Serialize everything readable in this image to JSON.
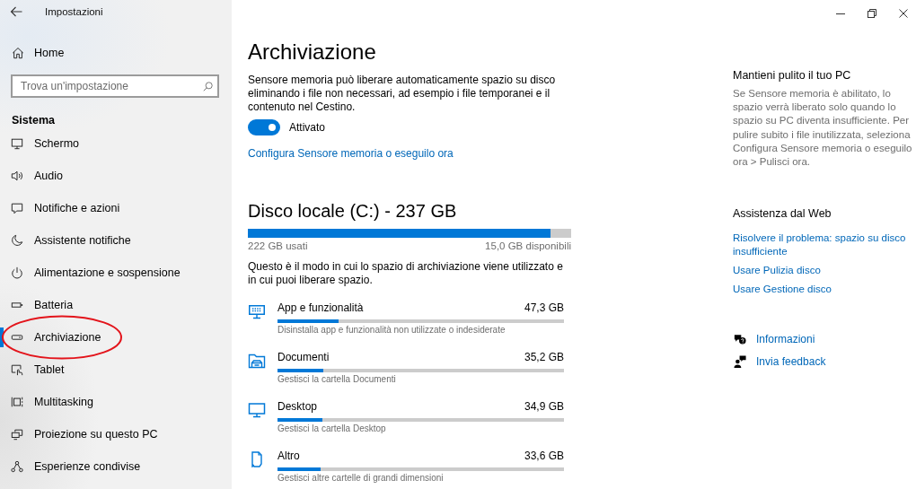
{
  "window": {
    "title": "Impostazioni"
  },
  "sidebar": {
    "home": "Home",
    "search": {
      "placeholder": "Trova un'impostazione"
    },
    "section": "Sistema",
    "items": [
      {
        "label": "Schermo",
        "selected": false,
        "circled": false
      },
      {
        "label": "Audio",
        "selected": false,
        "circled": false
      },
      {
        "label": "Notifiche e azioni",
        "selected": false,
        "circled": false
      },
      {
        "label": "Assistente notifiche",
        "selected": false,
        "circled": false
      },
      {
        "label": "Alimentazione e sospensione",
        "selected": false,
        "circled": false
      },
      {
        "label": "Batteria",
        "selected": false,
        "circled": false
      },
      {
        "label": "Archiviazione",
        "selected": true,
        "circled": true
      },
      {
        "label": "Tablet",
        "selected": false,
        "circled": false
      },
      {
        "label": "Multitasking",
        "selected": false,
        "circled": false
      },
      {
        "label": "Proiezione su questo PC",
        "selected": false,
        "circled": false
      },
      {
        "label": "Esperienze condivise",
        "selected": false,
        "circled": false
      }
    ]
  },
  "main": {
    "title": "Archiviazione",
    "description": "Sensore memoria può liberare automaticamente spazio su disco eliminando i file non necessari, ad esempio i file temporanei e il contenuto nel Cestino.",
    "toggle": {
      "on": true,
      "label": "Attivato"
    },
    "link": "Configura Sensore memoria o eseguilo ora",
    "disk": {
      "title": "Disco locale (C:) - 237 GB",
      "level": 0.937,
      "used": "222 GB usati",
      "free": "15,0 GB disponibili"
    },
    "intro": "Questo è il modo in cui lo spazio di archiviazione viene utilizzato e in cui puoi liberare spazio.",
    "categories": [
      {
        "name": "App e funzionalità",
        "size": "47,3 GB",
        "level": 0.212,
        "description": "Disinstalla app e funzionalità non utilizzate o indesiderate"
      },
      {
        "name": "Documenti",
        "size": "35,2 GB",
        "level": 0.16,
        "description": "Gestisci la cartella Documenti"
      },
      {
        "name": "Desktop",
        "size": "34,9 GB",
        "level": 0.157,
        "description": "Gestisci la cartella Desktop"
      },
      {
        "name": "Altro",
        "size": "33,6 GB",
        "level": 0.151,
        "description": "Gestisci altre cartelle di grandi dimensioni"
      }
    ]
  },
  "side_panel": {
    "tip": {
      "title": "Mantieni pulito il tuo PC",
      "text": "Se Sensore memoria è abilitato, lo spazio verrà liberato solo quando lo spazio su PC diventa insufficiente. Per pulire subito i file inutilizzata, seleziona Configura Sensore memoria o eseguilo ora > Pulisci ora."
    },
    "help": {
      "title": "Assistenza dal Web",
      "links": [
        "Risolvere il problema: spazio su disco insufficiente",
        "Usare Pulizia disco",
        "Usare Gestione disco"
      ]
    },
    "actions": [
      "Informazioni",
      "Invia feedback"
    ]
  }
}
